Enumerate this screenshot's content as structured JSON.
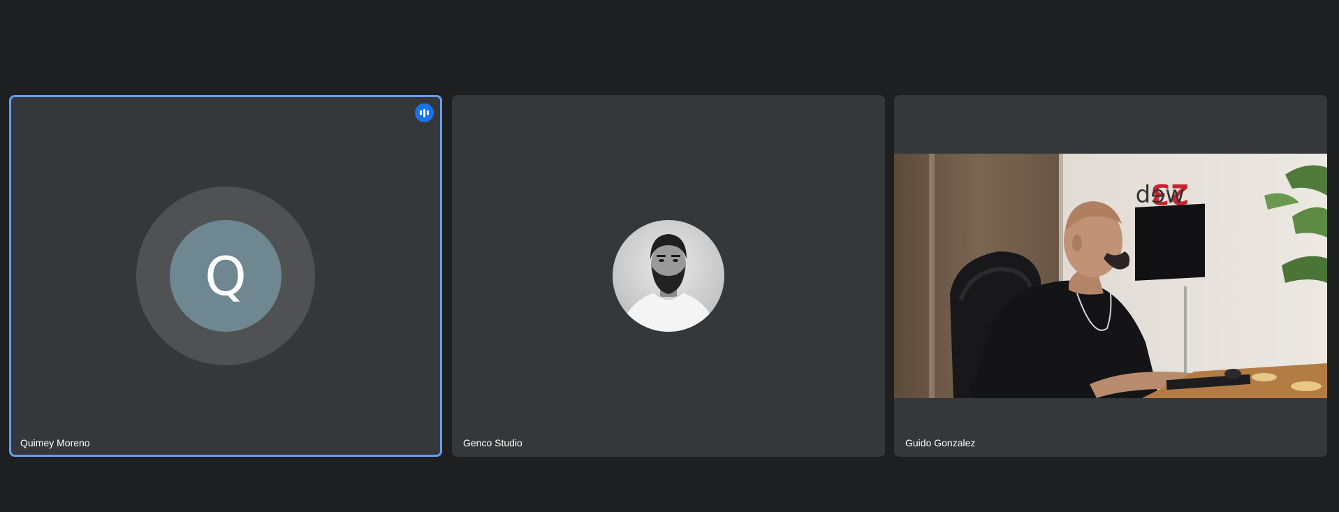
{
  "participants": [
    {
      "name": "Quimey Moreno",
      "initial": "Q",
      "speaking": true,
      "avatar_color": "#6f8791"
    },
    {
      "name": "Genco Studio",
      "avatar": "profile-photo"
    },
    {
      "name": "Guido Gonzalez",
      "video": "camera-feed",
      "wall_sign": "23web"
    }
  ],
  "colors": {
    "background": "#1e1f21",
    "tile": "#35383b",
    "active_border": "#669df6",
    "speaking_badge": "#1a73e8"
  }
}
